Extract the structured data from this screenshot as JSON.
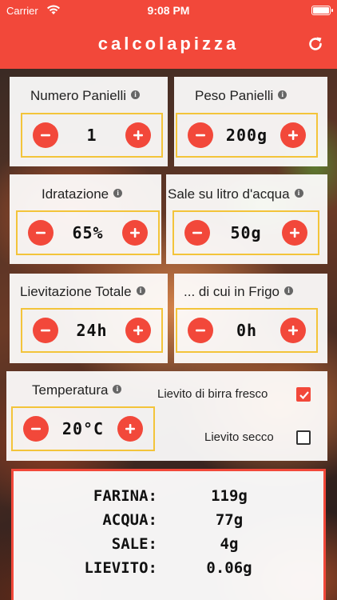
{
  "status_bar": {
    "carrier": "Carrier",
    "time": "9:08 PM"
  },
  "navbar": {
    "title": "calcolapizza"
  },
  "icons": {
    "info": "i"
  },
  "colors": {
    "accent": "#f2483a",
    "stepper_border": "#f3c43a"
  },
  "inputs": {
    "numero_panielli": {
      "label": "Numero Panielli",
      "value": "1"
    },
    "peso_panielli": {
      "label": "Peso Panielli",
      "value": "200g"
    },
    "idratazione": {
      "label": "Idratazione",
      "value": "65%"
    },
    "sale": {
      "label": "Sale su litro d'acqua",
      "value": "50g"
    },
    "lievitazione_totale": {
      "label": "Lievitazione Totale",
      "value": "24h"
    },
    "di_cui_in_frigo": {
      "label": "... di cui in Frigo",
      "value": "0h"
    },
    "temperatura": {
      "label": "Temperatura",
      "value": "20°C"
    }
  },
  "yeast": {
    "fresh": {
      "label": "Lievito di birra fresco",
      "checked": true
    },
    "dry": {
      "label": "Lievito secco",
      "checked": false
    }
  },
  "results": [
    {
      "key": "FARINA:",
      "value": "119g"
    },
    {
      "key": "ACQUA:",
      "value": "77g"
    },
    {
      "key": "SALE:",
      "value": "4g"
    },
    {
      "key": "LIEVITO:",
      "value": "0.06g"
    }
  ]
}
